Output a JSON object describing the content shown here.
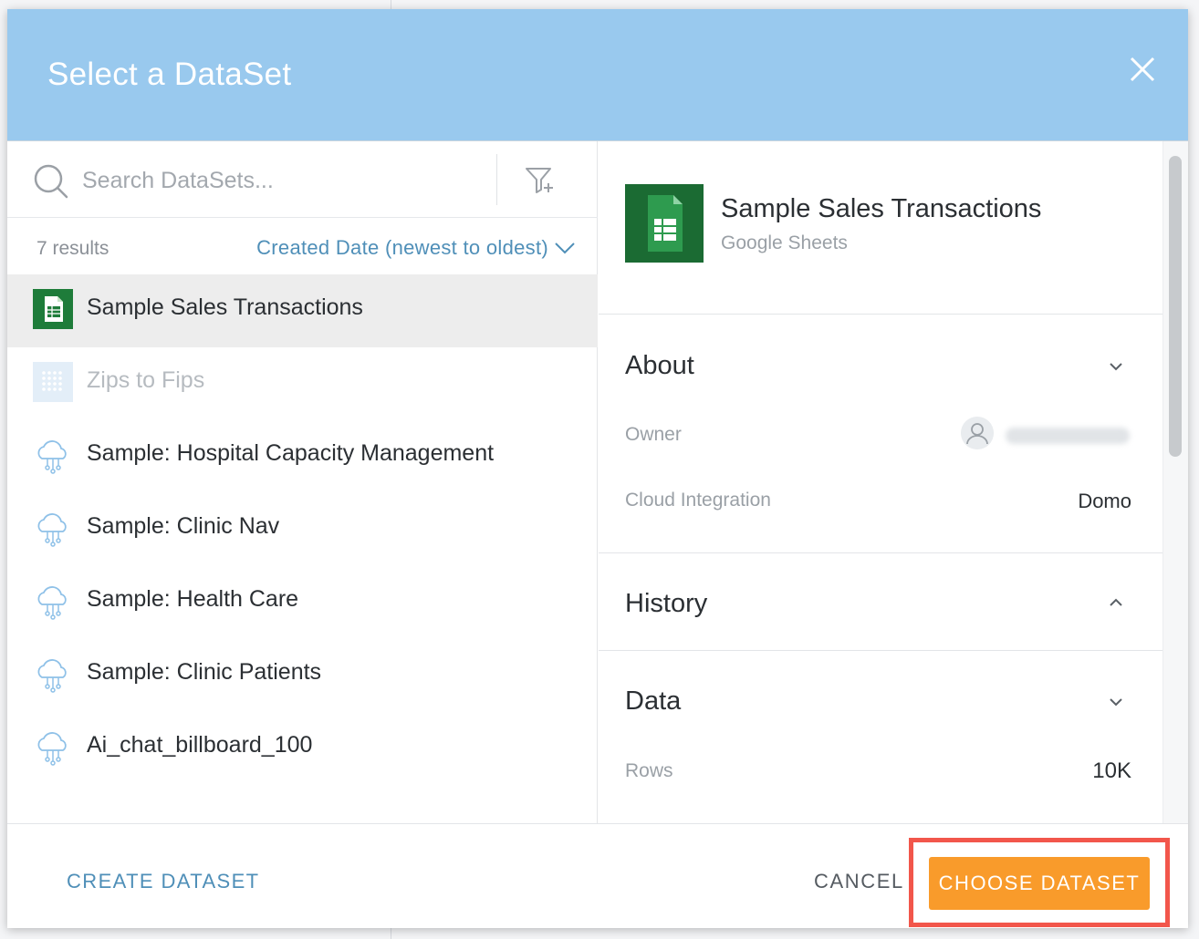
{
  "modal": {
    "title": "Select a DataSet"
  },
  "search": {
    "placeholder": "Search DataSets..."
  },
  "results": {
    "count_label": "7 results",
    "sort_label": "Created Date (newest to oldest)"
  },
  "datasets": [
    {
      "label": "Sample Sales Transactions",
      "icon": "google-sheets-icon",
      "selected": true
    },
    {
      "label": "Zips to Fips",
      "icon": "grid-dataset-icon",
      "disabled": true
    },
    {
      "label": "Sample: Hospital Capacity Management",
      "icon": "cloud-connector-icon"
    },
    {
      "label": "Sample: Clinic Nav",
      "icon": "cloud-connector-icon"
    },
    {
      "label": "Sample: Health Care",
      "icon": "cloud-connector-icon"
    },
    {
      "label": "Sample: Clinic Patients",
      "icon": "cloud-connector-icon"
    },
    {
      "label": "Ai_chat_billboard_100",
      "icon": "cloud-connector-icon"
    }
  ],
  "detail": {
    "title": "Sample Sales Transactions",
    "subtitle": "Google Sheets",
    "about": {
      "title": "About",
      "owner_label": "Owner",
      "cloud_label": "Cloud Integration",
      "cloud_value": "Domo"
    },
    "history": {
      "title": "History"
    },
    "data": {
      "title": "Data",
      "rows_label": "Rows",
      "rows_value": "10K"
    }
  },
  "footer": {
    "create_label": "CREATE DATASET",
    "cancel_label": "CANCEL",
    "choose_label": "CHOOSE DATASET"
  },
  "colors": {
    "header": "#99c9ee",
    "link": "#4f8fb8",
    "primary_button": "#f99b2b",
    "highlight": "#f2564b",
    "sheets_green": "#1e7c3a"
  }
}
